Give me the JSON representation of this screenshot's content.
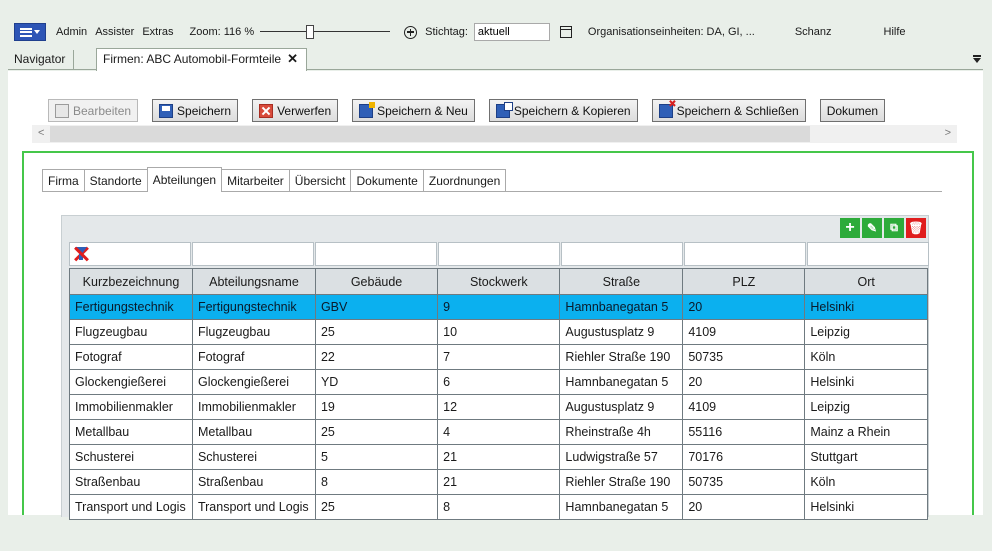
{
  "menubar": {
    "items": [
      "Admin",
      "Assister",
      "Extras"
    ],
    "zoom_label": "Zoom: 116 %",
    "stichtag_label": "Stichtag:",
    "stichtag_value": "aktuell",
    "org_label": "Organisationseinheiten: DA, GI, ...",
    "user": "Schanz",
    "help": "Hilfe"
  },
  "docbar": {
    "navigator": "Navigator",
    "doc_tab": "Firmen: ABC Automobil-Formteile",
    "close_glyph": "✕"
  },
  "toolbar": {
    "edit": "Bearbeiten",
    "save": "Speichern",
    "discard": "Verwerfen",
    "save_new": "Speichern & Neu",
    "save_copy": "Speichern & Kopieren",
    "save_close": "Speichern & Schließen",
    "documents": "Dokumen"
  },
  "scroll": {
    "left": "<",
    "right": ">"
  },
  "tabs": [
    "Firma",
    "Standorte",
    "Abteilungen",
    "Mitarbeiter",
    "Übersicht",
    "Dokumente",
    "Zuordnungen"
  ],
  "active_tab": "Abteilungen",
  "grid": {
    "actions": {
      "add": "+",
      "edit": "✎",
      "copy": "⧉",
      "delete": "🗑"
    },
    "columns": [
      "Kurzbezeichnung",
      "Abteilungsname",
      "Gebäude",
      "Stockwerk",
      "Straße",
      "PLZ",
      "Ort"
    ],
    "rows": [
      [
        "Fertigungstechnik",
        "Fertigungstechnik",
        "GBV",
        "9",
        "Hamnbanegatan 5",
        "20",
        "Helsinki"
      ],
      [
        "Flugzeugbau",
        "Flugzeugbau",
        "25",
        "10",
        "Augustusplatz 9",
        "4109",
        "Leipzig"
      ],
      [
        "Fotograf",
        "Fotograf",
        "22",
        "7",
        "Riehler Straße 190",
        "50735",
        "Köln"
      ],
      [
        "Glockengießerei",
        "Glockengießerei",
        "YD",
        "6",
        "Hamnbanegatan 5",
        "20",
        "Helsinki"
      ],
      [
        "Immobilienmakler",
        "Immobilienmakler",
        "19",
        "12",
        "Augustusplatz 9",
        "4109",
        "Leipzig"
      ],
      [
        "Metallbau",
        "Metallbau",
        "25",
        "4",
        "Rheinstraße 4h",
        "55116",
        "Mainz a Rhein"
      ],
      [
        "Schusterei",
        "Schusterei",
        "5",
        "21",
        "Ludwigstraße 57",
        "70176",
        "Stuttgart"
      ],
      [
        "Straßenbau",
        "Straßenbau",
        "8",
        "21",
        "Riehler Straße 190",
        "50735",
        "Köln"
      ],
      [
        "Transport und Logis",
        "Transport und Logis",
        "25",
        "8",
        "Hamnbanegatan 5",
        "20",
        "Helsinki"
      ]
    ],
    "selected_row": 0
  }
}
